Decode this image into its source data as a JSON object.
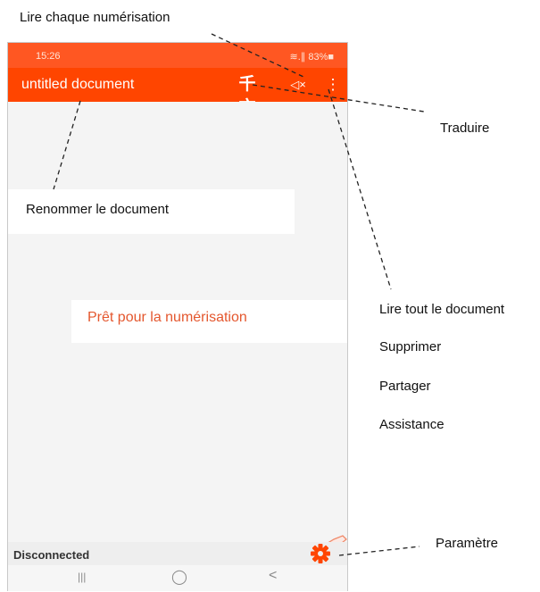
{
  "callouts": {
    "read_each_scan": "Lire chaque numérisation",
    "translate": "Traduire",
    "rename_document": "Renommer le document",
    "read_all": "Lire tout le document",
    "delete": "Supprimer",
    "share": "Partager",
    "assistance": "Assistance",
    "settings": "Paramètre"
  },
  "phone": {
    "status_bar": {
      "time": "15:26",
      "indicators": "≋.∥ 83%■"
    },
    "app_bar": {
      "title": "untitled document",
      "translate_icon": "translate-icon",
      "speaker_icon": "speaker-mute-icon",
      "overflow_icon": "more-vert-icon"
    },
    "main": {
      "ready_text": "Prêt pour la numérisation"
    },
    "bottom_bar": {
      "connection_status": "Disconnected",
      "settings_icon": "gear-icon"
    },
    "nav": {
      "recents": "|||",
      "home": "◯",
      "back": "<"
    }
  },
  "colors": {
    "accent": "#ff4500",
    "status_bar": "#ff5722",
    "ready_text": "#e4572e",
    "gear": "#ff4500"
  }
}
